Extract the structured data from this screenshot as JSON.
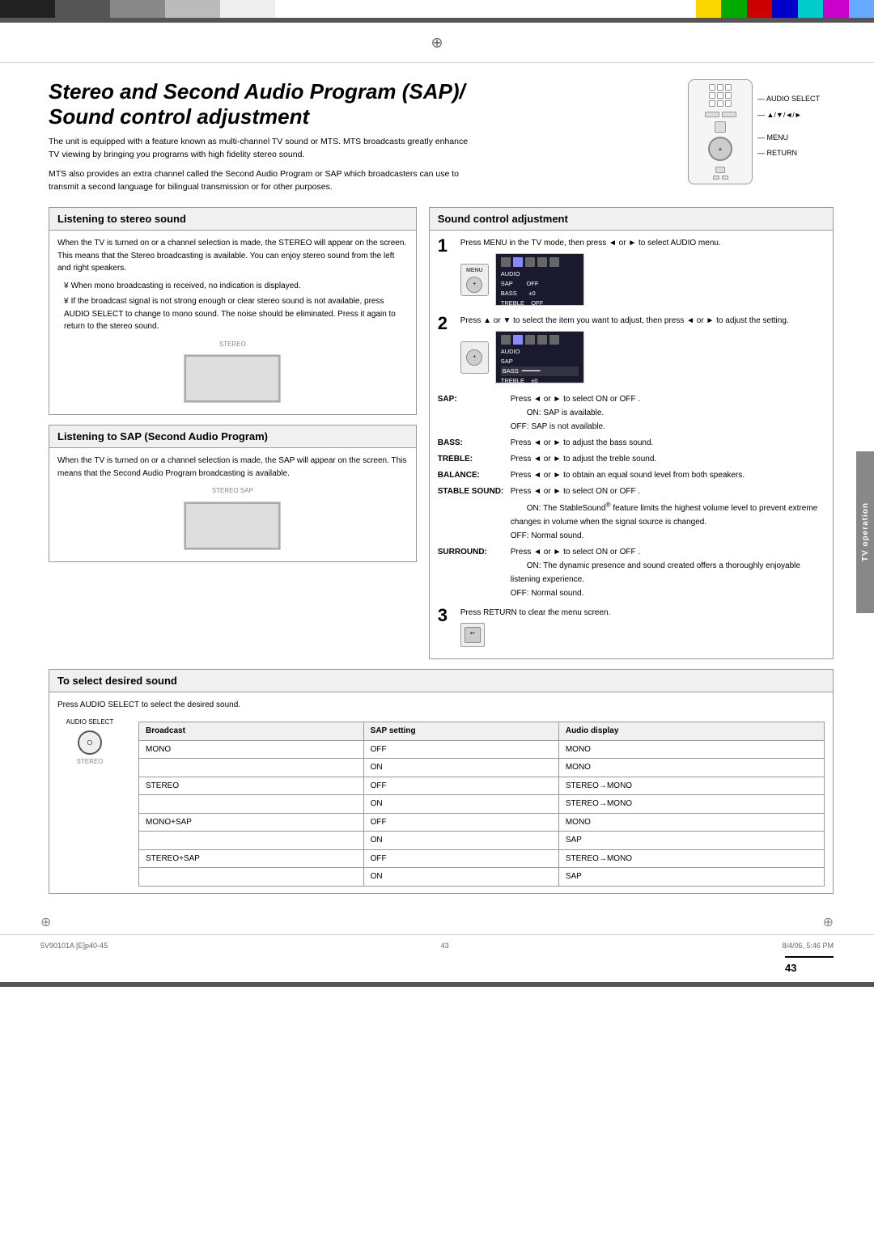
{
  "page": {
    "number": "43",
    "doc_id": "5V90101A [E]p40-45",
    "date": "8/4/06, 5:46 PM"
  },
  "title": {
    "line1": "Stereo and Second Audio Program (SAP)/",
    "line2": "Sound control adjustment"
  },
  "intro": {
    "para1": "The unit is equipped with a feature known as multi-channel TV sound or MTS. MTS broadcasts greatly enhance TV viewing by bringing you programs with high fidelity stereo sound.",
    "para2": "MTS also provides an extra channel called the Second Audio Program or SAP which broadcasters can use to transmit a second language for bilingual transmission or for other purposes."
  },
  "remote_labels": {
    "audio_select": "AUDIO SELECT",
    "nav": "▲/▼/◄/►",
    "menu": "MENU",
    "return": "RETURN"
  },
  "listening_stereo": {
    "header": "Listening to stereo sound",
    "body": "When the TV is turned on or a channel selection is made, the STEREO will appear on the screen. This means that the Stereo broadcasting is available. You can enjoy stereo sound from the left and right speakers.",
    "bullets": [
      "When mono broadcasting is received, no indication is displayed.",
      "If the broadcast signal is not strong enough or clear stereo sound is not available, press AUDIO SELECT to change to mono sound. The noise should be eliminated. Press it again to return to the stereo sound."
    ],
    "tv_label": "STEREO"
  },
  "listening_sap": {
    "header": "Listening to SAP (Second Audio Program)",
    "body": "When the TV is turned on or a channel selection is made, the SAP will appear on the screen. This means that the Second Audio Program broadcasting is available.",
    "tv_label": "STEREO SAP"
  },
  "sound_control": {
    "header": "Sound control adjustment",
    "step1": {
      "number": "1",
      "text": "Press MENU in the TV mode, then press  ◄  or  ►  to select AUDIO  menu."
    },
    "step2": {
      "number": "2",
      "text": "Press ▲ or ▼ to select the item you want to adjust, then press  ◄  or  ►  to adjust the setting."
    },
    "step3": {
      "number": "3",
      "text": "Press RETURN to clear the menu screen."
    },
    "details": [
      {
        "label": "SAP:",
        "text": "Press ◄ or ► to select  ON  or  OFF .",
        "sub": [
          "ON: SAP is available.",
          "OFF: SAP is not available."
        ]
      },
      {
        "label": "BASS:",
        "text": "Press ◄ or ► to adjust the bass sound."
      },
      {
        "label": "TREBLE:",
        "text": "Press ◄ or ► to adjust the treble sound."
      },
      {
        "label": "BALANCE:",
        "text": "Press ◄ or ► to obtain an equal sound level from both speakers."
      },
      {
        "label": "STABLE SOUND:",
        "text": "Press ◄ or ► to select  ON  or  OFF .",
        "sub": [
          "ON: The StableSound® feature limits the highest volume level to prevent extreme changes in volume when the signal source is changed.",
          "OFF: Normal sound."
        ]
      },
      {
        "label": "SURROUND:",
        "text": "Press ◄ or ► to select  ON  or  OFF .",
        "sub": [
          "ON: The dynamic presence and sound created offers a thoroughly enjoyable listening experience.",
          "OFF: Normal sound."
        ]
      }
    ]
  },
  "to_select": {
    "header": "To select desired sound",
    "instruction": "Press AUDIO SELECT to select the desired sound.",
    "audio_label": "AUDIO SELECT",
    "tv_label": "STEREO",
    "table": {
      "headers": [
        "Broadcast",
        "SAP setting",
        "Audio display"
      ],
      "rows": [
        [
          "MONO",
          "OFF",
          "MONO"
        ],
        [
          "",
          "ON",
          "MONO"
        ],
        [
          "STEREO",
          "OFF",
          "STEREO→MONO"
        ],
        [
          "",
          "ON",
          "STEREO→MONO"
        ],
        [
          "MONO+SAP",
          "OFF",
          "MONO"
        ],
        [
          "",
          "ON",
          "SAP"
        ],
        [
          "STEREO+SAP",
          "OFF",
          "STEREO→MONO"
        ],
        [
          "",
          "ON",
          "SAP"
        ]
      ]
    }
  },
  "tv_operation": "TV operation"
}
